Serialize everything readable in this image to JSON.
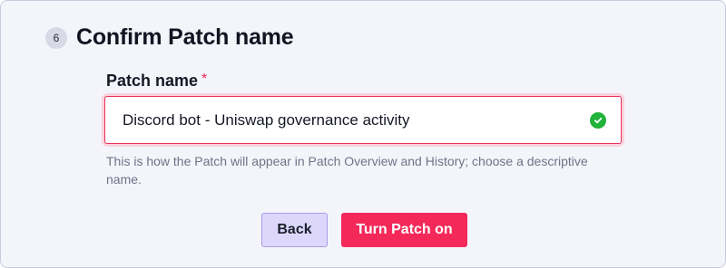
{
  "step": {
    "number": "6",
    "title": "Confirm Patch name"
  },
  "field": {
    "label": "Patch name",
    "required_marker": "*",
    "value": "Discord bot - Uniswap governance activity",
    "valid_icon": "check-circle-icon",
    "helper_text": "This is how the Patch will appear in Patch Overview and History; choose a descriptive name."
  },
  "actions": {
    "back_label": "Back",
    "primary_label": "Turn Patch on"
  },
  "colors": {
    "accent": "#f4295a",
    "success": "#22b33a",
    "secondary_button": "#ddd8fb"
  }
}
